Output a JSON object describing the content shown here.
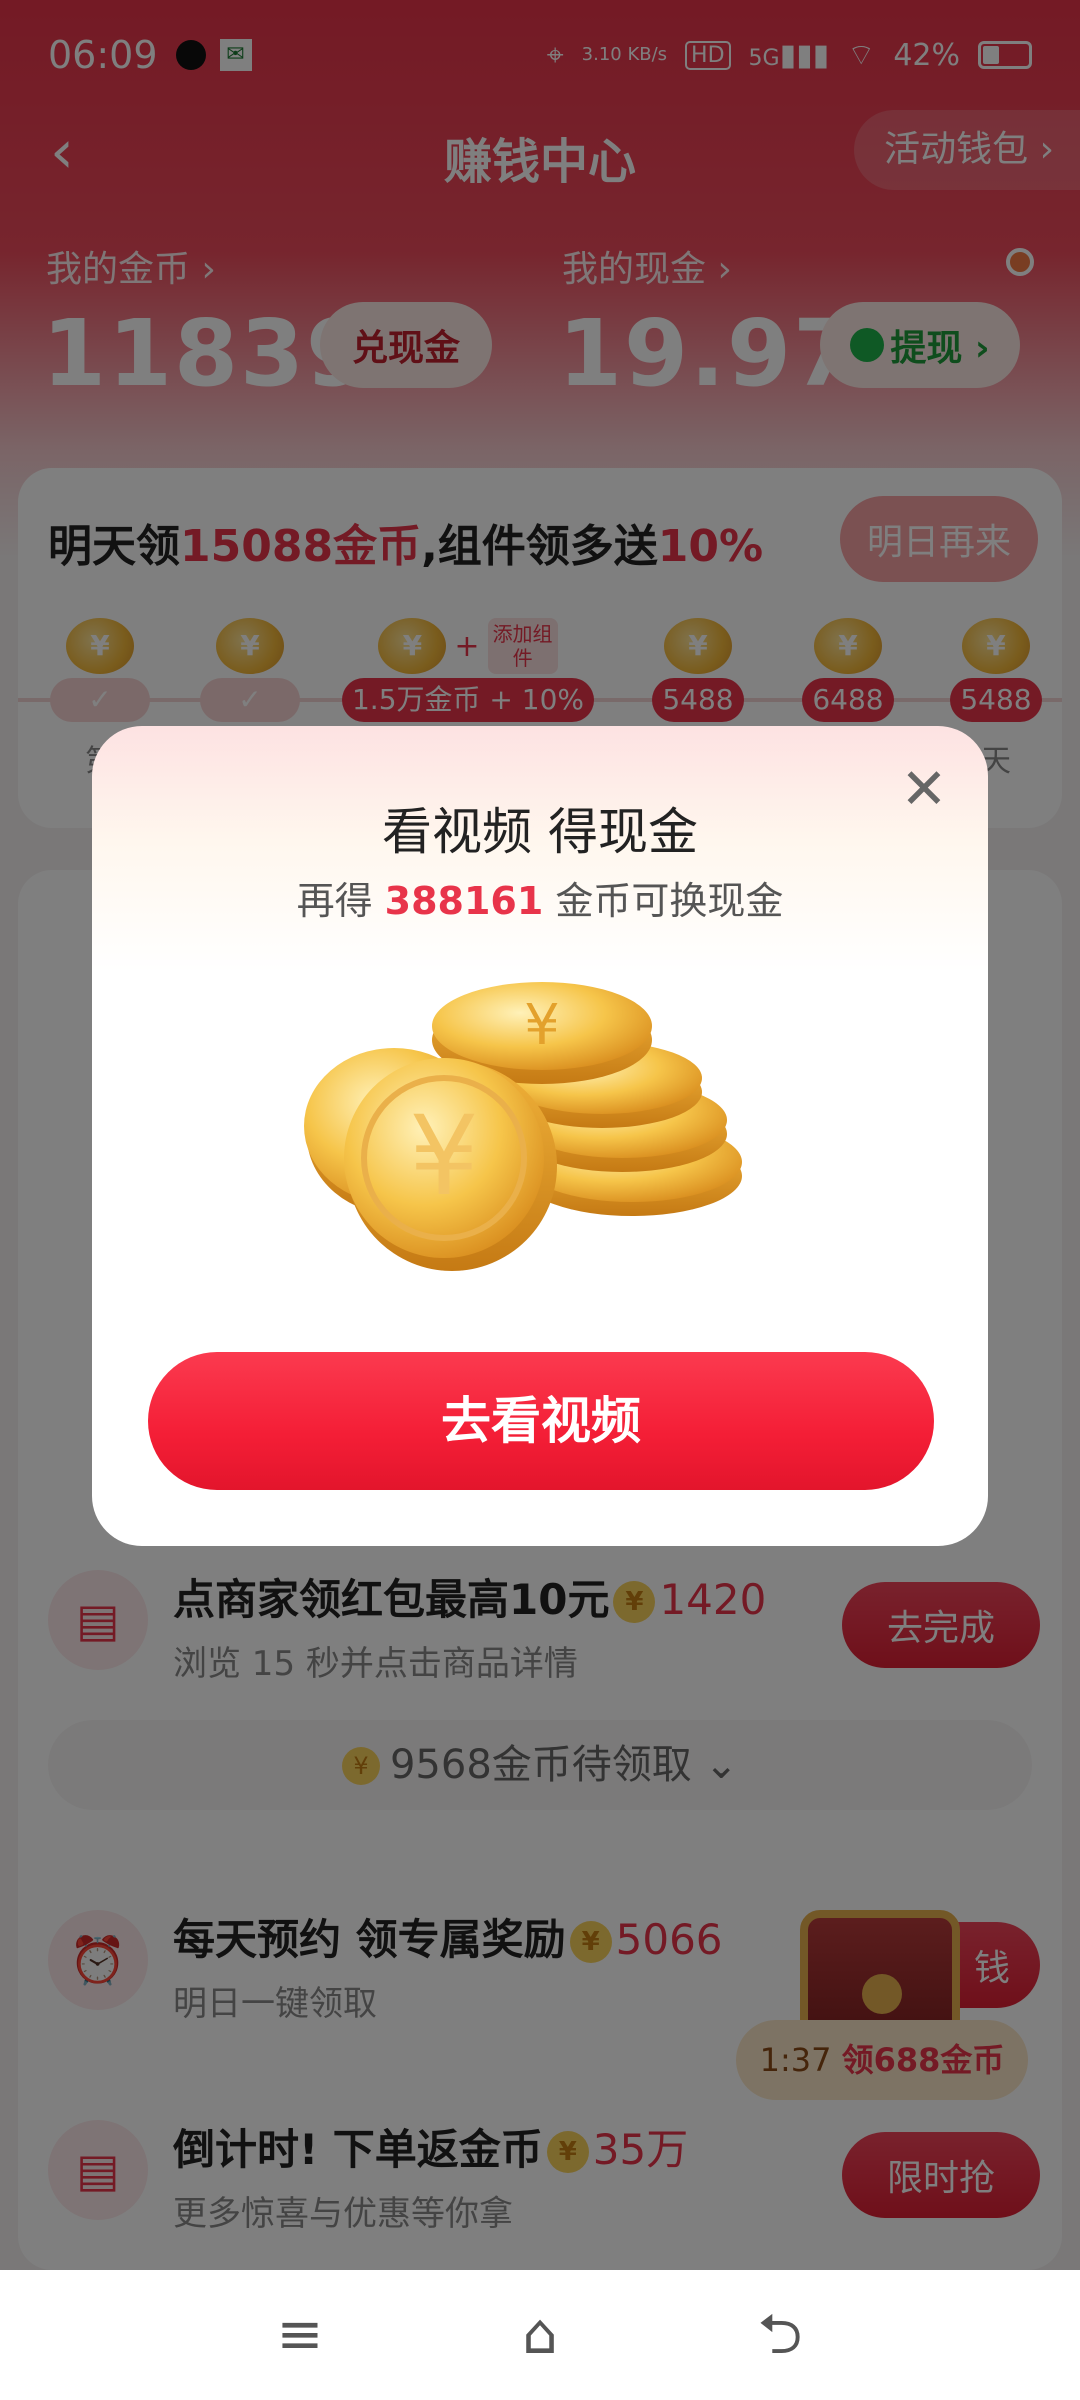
{
  "status_bar": {
    "time": "06:09",
    "speed": "3.10 KB/s",
    "hd": "HD",
    "net": "5G",
    "battery": "42%"
  },
  "nav": {
    "title": "赚钱中心",
    "back_icon": "chevron-left-icon",
    "wallet_label": "活动钱包",
    "wallet_chevron": "›"
  },
  "balances": {
    "coins_label": "我的金币 ›",
    "coins_value": "11839",
    "coins_button": "兑现金",
    "cash_label": "我的现金 ›",
    "cash_value": "19.97",
    "cash_button": "提现 ›"
  },
  "checkin": {
    "title_prefix": "明天领",
    "title_amount": "15088金币",
    "title_middle": ",组件领多送",
    "title_percent": "10%",
    "button": "明日再来",
    "widget_tag": "添加组件",
    "days": [
      {
        "tag": "✓",
        "label": "第"
      },
      {
        "tag": "✓",
        "label": ""
      },
      {
        "tag": "1.5万金币 + 10%",
        "label": ""
      },
      {
        "tag": "5488",
        "label": ""
      },
      {
        "tag": "6488",
        "label": ""
      },
      {
        "tag": "5488",
        "label": "天"
      }
    ]
  },
  "tasks": {
    "shop": {
      "title": "点商家领红包最高10元",
      "reward": "1420",
      "subtitle": "浏览 15 秒并点击商品详情",
      "button": "去完成"
    },
    "more": "9568金币待领取",
    "reserve": {
      "title": "每天预约 领专属奖励",
      "reward": "5066",
      "subtitle": "明日一键领取",
      "button": "钱"
    },
    "countdown": {
      "title": "倒计时! 下单返金币",
      "reward": "35万",
      "subtitle": "更多惊喜与优惠等你拿",
      "button": "限时抢"
    }
  },
  "chest": {
    "timer": "1:37",
    "text": "领688金币"
  },
  "modal": {
    "title": "看视频 得现金",
    "sub_prefix": "再得 ",
    "sub_number": "388161",
    "sub_suffix": " 金币可换现金",
    "cta": "去看视频"
  },
  "colors": {
    "brand_red": "#e8344a",
    "gold": "#f4b93a"
  }
}
